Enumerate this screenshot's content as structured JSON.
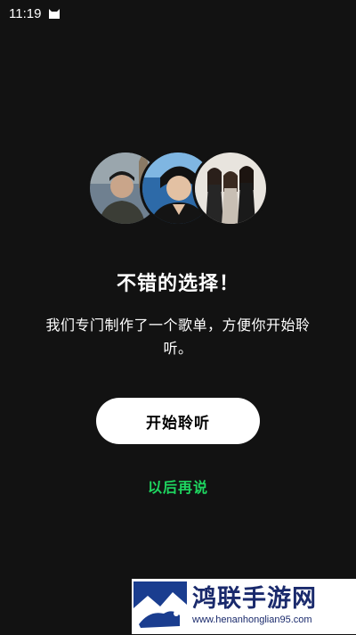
{
  "status_bar": {
    "time": "11:19",
    "notification_icon": "cat-icon"
  },
  "avatars": [
    {
      "name": "artist-avatar-1",
      "palette": [
        "#5b6f7d",
        "#8a7a65",
        "#2a2a2a"
      ]
    },
    {
      "name": "artist-avatar-2",
      "palette": [
        "#1f4f86",
        "#6aa3d6",
        "#111111"
      ]
    },
    {
      "name": "artist-avatar-3",
      "palette": [
        "#d9d4cc",
        "#2b2b2b",
        "#a89a8a"
      ]
    }
  ],
  "title": "不错的选择！",
  "subtitle": "我们专门制作了一个歌单，方便你开始聆听。",
  "primary_button_label": "开始聆听",
  "later_link_label": "以后再说",
  "watermark": {
    "name": "鸿联手游网",
    "url": "www.henanhonglian95.com"
  },
  "colors": {
    "background": "#121212",
    "accent": "#1ed760",
    "button": "#ffffff"
  }
}
